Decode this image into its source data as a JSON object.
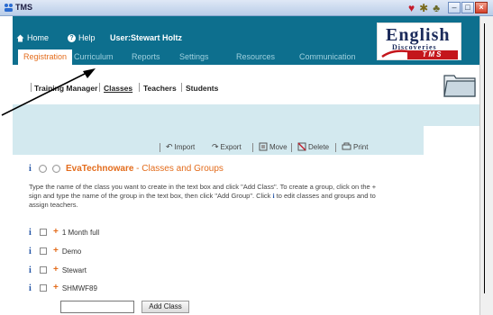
{
  "window": {
    "title": "TMS"
  },
  "header": {
    "home_label": "Home",
    "help_label": "Help",
    "user_label": "User:Stewart Holtz"
  },
  "logo": {
    "line1": "English",
    "line2": "Discoveries",
    "line3": "TMS"
  },
  "tabs": [
    {
      "label": "Registration",
      "active": true
    },
    {
      "label": "Curriculum",
      "active": false
    },
    {
      "label": "Reports",
      "active": false
    },
    {
      "label": "Settings",
      "active": false
    },
    {
      "label": "Resources",
      "active": false
    },
    {
      "label": "Communication",
      "active": false
    }
  ],
  "subnav": {
    "items": [
      {
        "label": "Training Manager"
      },
      {
        "label": "Classes"
      },
      {
        "label": "Teachers"
      },
      {
        "label": "Students"
      }
    ]
  },
  "toolbar": {
    "import": "Import",
    "export": "Export",
    "move": "Move",
    "delete": "Delete",
    "print": "Print"
  },
  "section": {
    "org_name": "EvaTechnoware",
    "org_suffix": " - Classes and Groups"
  },
  "instructions": {
    "part1": "Type the name of the class you want to create in the text box and click \"Add Class\". To create a group, click on the + sign and type the name of the group in the text box, then click \"Add Group\". Click ",
    "part2": " to edit classes and groups and to assign teachers."
  },
  "classes": [
    {
      "name": "1 Month full"
    },
    {
      "name": "Demo"
    },
    {
      "name": "Stewart"
    },
    {
      "name": "SHMWF89"
    }
  ],
  "add_class": {
    "button_label": "Add Class",
    "input_value": ""
  },
  "colors": {
    "header_teal": "#0d6f8e",
    "accent_orange": "#e36c1c",
    "band_light": "#d3e9ef",
    "logo_red": "#c4161c"
  }
}
